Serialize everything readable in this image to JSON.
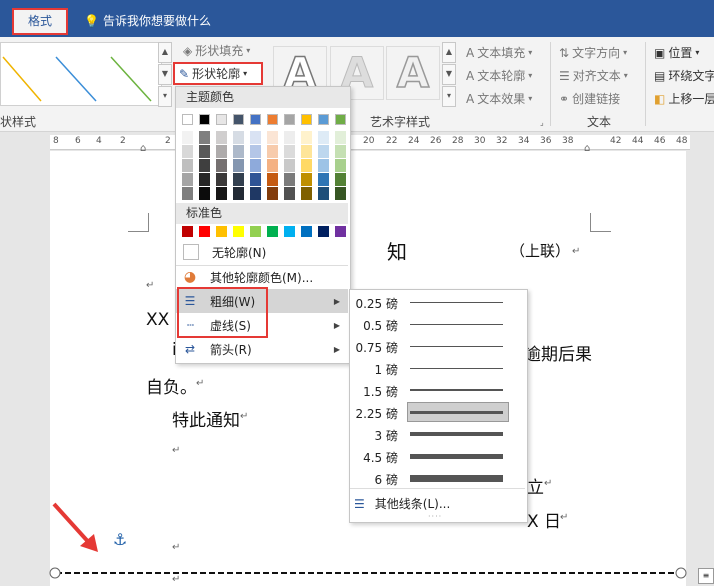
{
  "titlebar": {
    "active_tab": "格式",
    "tell_me": "告诉我你想要做什么"
  },
  "ribbon": {
    "shape_fill": "形状填充",
    "shape_outline": "形状轮廓",
    "shape_styles_label": "状样式",
    "wordart_label": "艺术字样式",
    "text_fill": "文本填充",
    "text_outline": "文本轮廓",
    "text_effects": "文本效果",
    "text_direction": "文字方向",
    "align_text": "对齐文本",
    "create_link": "创建链接",
    "text_group_label": "文本",
    "position": "位置",
    "wrap_text": "环绕文字",
    "bring_forward": "上移一层"
  },
  "ruler": {
    "ticks": [
      "8",
      "6",
      "4",
      "2",
      "2",
      "20",
      "22",
      "24",
      "26",
      "28",
      "30",
      "32",
      "34",
      "36",
      "38",
      "42",
      "44",
      "46",
      "48"
    ]
  },
  "menu": {
    "theme_colors_title": "主题颜色",
    "standard_colors_title": "标准色",
    "no_outline": "无轮廓(N)",
    "more_colors": "其他轮廓颜色(M)...",
    "weight": "粗细(W)",
    "dashes": "虚线(S)",
    "arrows": "箭头(R)",
    "theme_top_row": [
      "#ffffff",
      "#000000",
      "#e7e6e6",
      "#44546a",
      "#4472c4",
      "#ed7d31",
      "#a5a5a5",
      "#ffc000",
      "#5b9bd5",
      "#70ad47"
    ],
    "theme_shades": [
      [
        "#f2f2f2",
        "#7f7f7f",
        "#d0cece",
        "#d6dce4",
        "#d9e2f3",
        "#fbe5d5",
        "#ededed",
        "#fff2cc",
        "#deebf6",
        "#e2efd9"
      ],
      [
        "#d8d8d8",
        "#595959",
        "#aeabab",
        "#adb9ca",
        "#b4c6e7",
        "#f7cbac",
        "#dbdbdb",
        "#fee599",
        "#bdd7ee",
        "#c5e0b3"
      ],
      [
        "#bfbfbf",
        "#3f3f3f",
        "#757070",
        "#8496b0",
        "#8eaadb",
        "#f4b183",
        "#c9c9c9",
        "#ffd965",
        "#9dc3e6",
        "#a8d08d"
      ],
      [
        "#a5a5a5",
        "#262626",
        "#3a3838",
        "#323f4f",
        "#2f5496",
        "#c55a11",
        "#7b7b7b",
        "#bf8f00",
        "#2e75b5",
        "#538135"
      ],
      [
        "#7f7f7f",
        "#0c0c0c",
        "#171616",
        "#222a35",
        "#1f3864",
        "#833c0b",
        "#525252",
        "#7f6000",
        "#1e4e79",
        "#375623"
      ]
    ],
    "standard_colors": [
      "#c00000",
      "#ff0000",
      "#ffc000",
      "#ffff00",
      "#92d050",
      "#00b050",
      "#00b0f0",
      "#0070c0",
      "#002060",
      "#7030a0"
    ]
  },
  "weights": {
    "items": [
      {
        "label": "0.25 磅",
        "value": 0.25
      },
      {
        "label": "0.5 磅",
        "value": 0.5
      },
      {
        "label": "0.75 磅",
        "value": 0.75
      },
      {
        "label": "1 磅",
        "value": 1
      },
      {
        "label": "1.5 磅",
        "value": 1.5
      },
      {
        "label": "2.25 磅",
        "value": 2.25
      },
      {
        "label": "3 磅",
        "value": 3
      },
      {
        "label": "4.5 磅",
        "value": 4.5
      },
      {
        "label": "6 磅",
        "value": 6
      }
    ],
    "selected": "2.25 磅",
    "more_lines": "其他线条(L)..."
  },
  "document": {
    "title_char": "知",
    "title_suffix": "（上联）",
    "line_xx": "XX 陪",
    "line_overdue": "逾期后果",
    "line_self": "自负。",
    "line_notice": "特此通知",
    "line_li": "立",
    "line_xday": "X 日"
  }
}
